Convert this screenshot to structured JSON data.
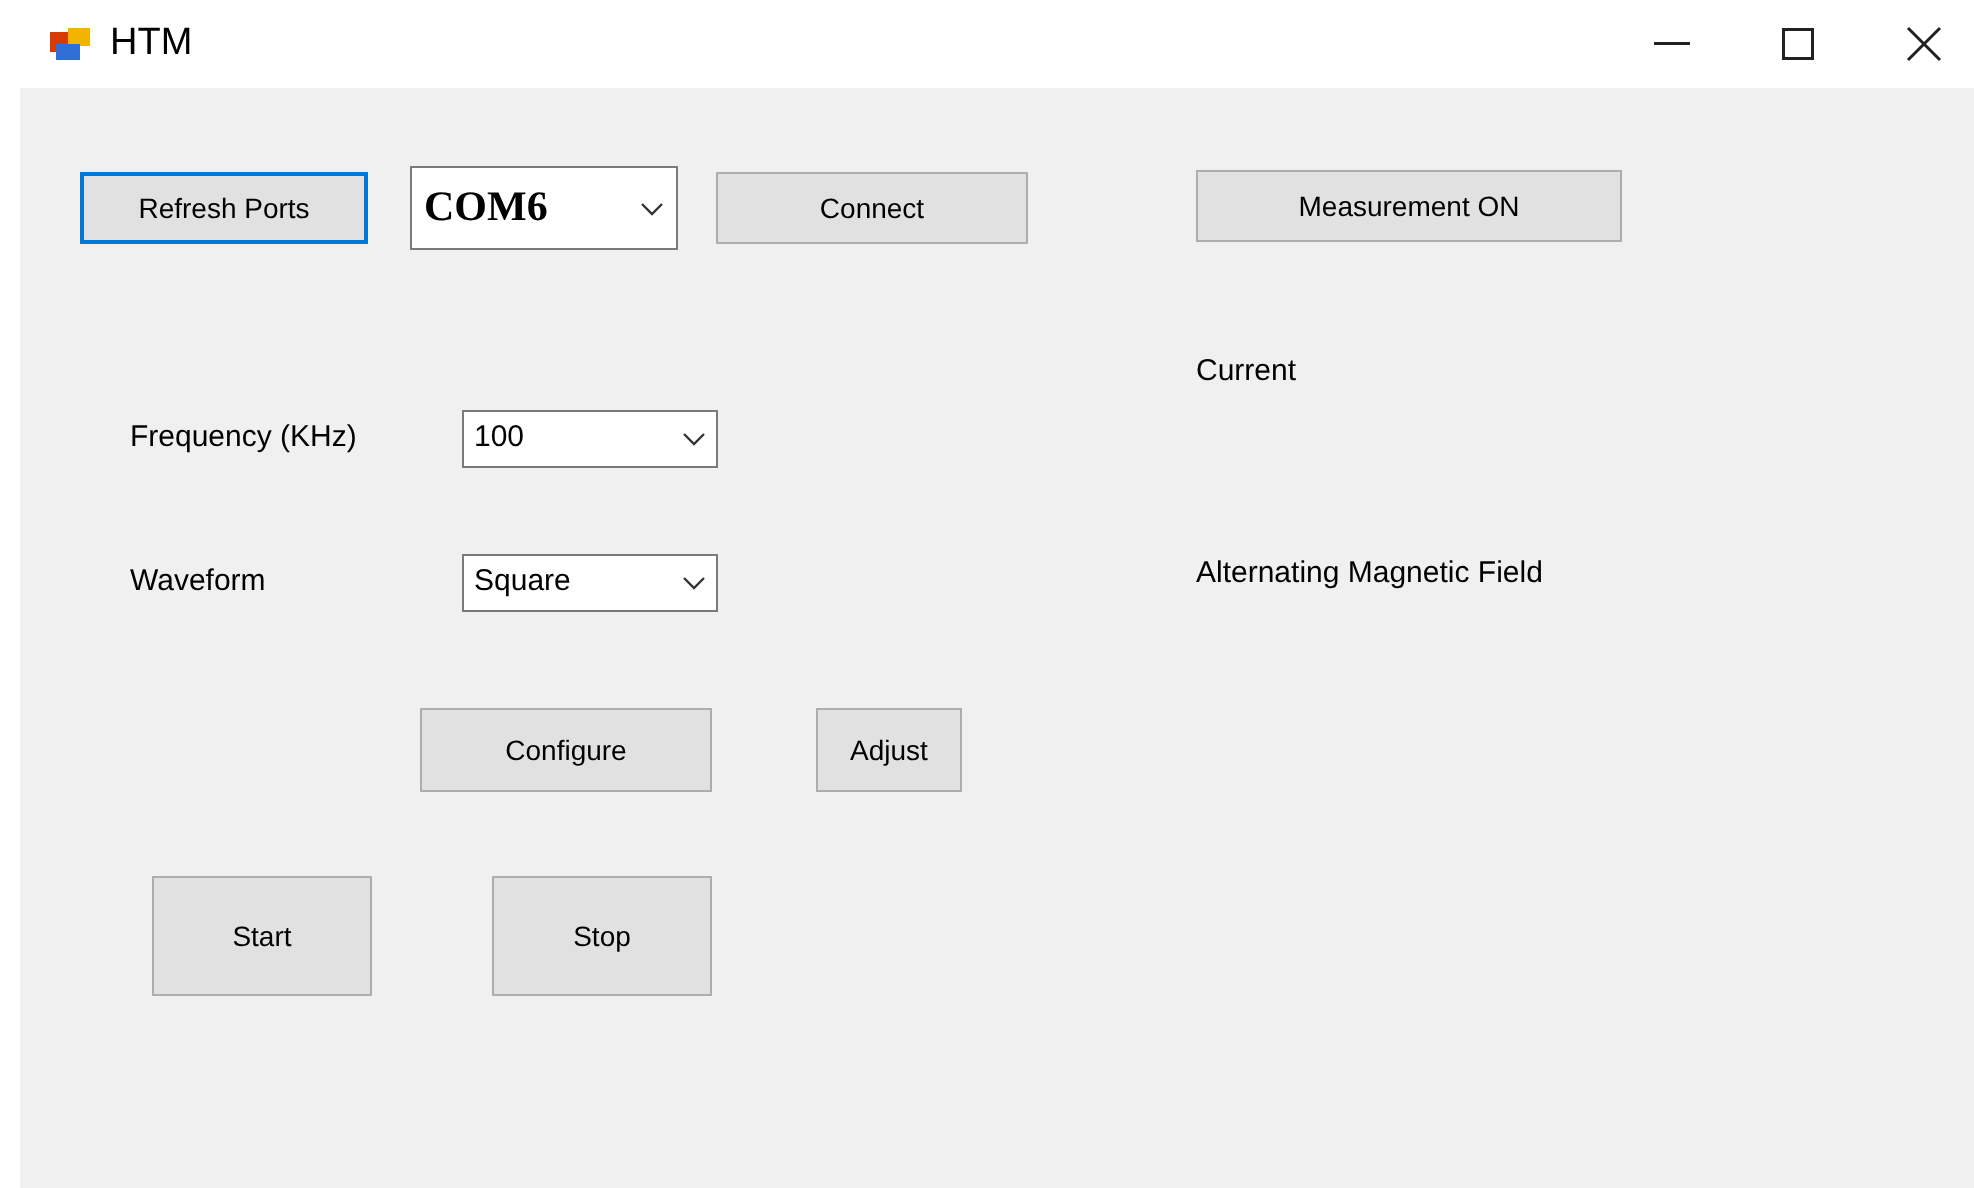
{
  "window": {
    "title": "HTM"
  },
  "port_row": {
    "refresh": {
      "label": "Refresh Ports",
      "focused": true
    },
    "port": {
      "value": "COM6"
    },
    "connect": {
      "label": "Connect",
      "focused": false
    }
  },
  "settings": [
    {
      "label": "Frequency (KHz)",
      "value": "100"
    },
    {
      "label": "Waveform",
      "value": "Square"
    }
  ],
  "configure": {
    "label": "Configure",
    "focused": false
  },
  "adjust": {
    "label": "Adjust",
    "focused": false
  },
  "start": {
    "label": "Start",
    "focused": false
  },
  "stop": {
    "label": "Stop",
    "focused": false
  },
  "measurement": {
    "label": "Measurement ON",
    "focused": false
  },
  "readouts": [
    "Current",
    "Alternating Magnetic Field"
  ]
}
